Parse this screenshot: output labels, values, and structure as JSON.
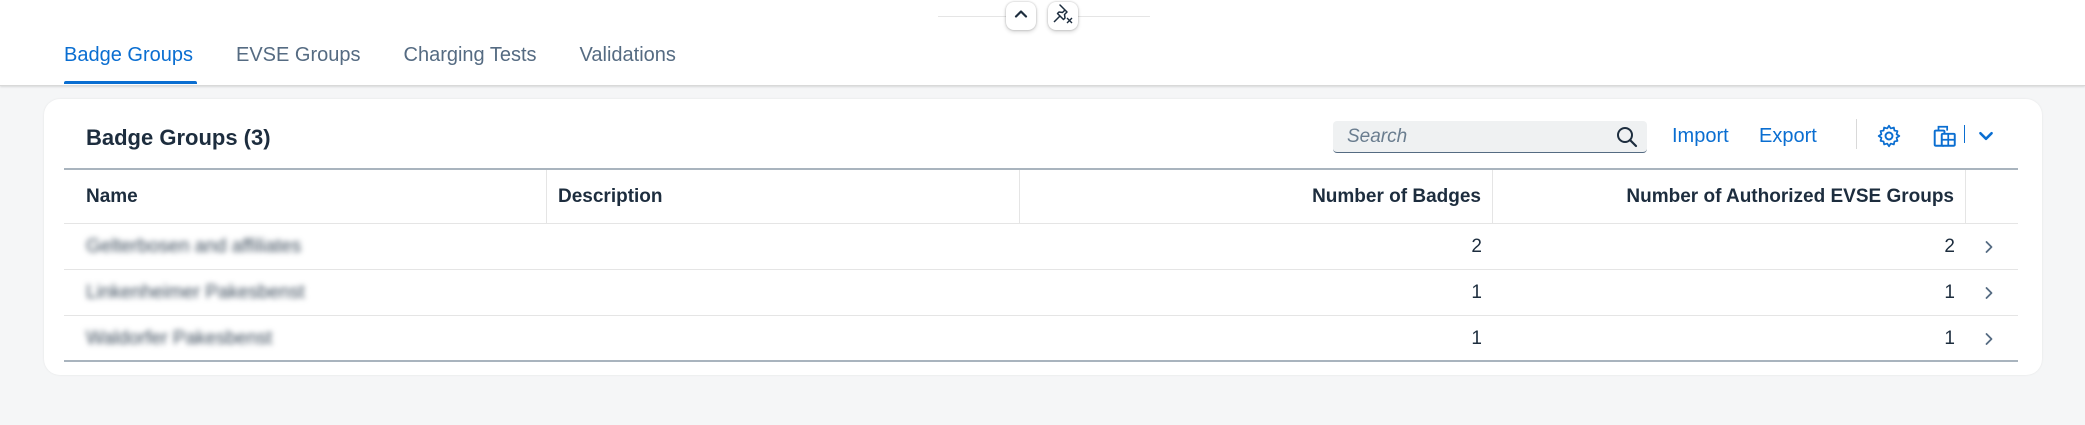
{
  "header": {
    "collapse_icon": "chevron-up-icon",
    "unpin_icon": "unpin-icon"
  },
  "tabs": [
    {
      "label": "Badge Groups",
      "active": true
    },
    {
      "label": "EVSE Groups",
      "active": false
    },
    {
      "label": "Charging Tests",
      "active": false
    },
    {
      "label": "Validations",
      "active": false
    }
  ],
  "card": {
    "title": "Badge Groups (3)",
    "search_placeholder": "Search",
    "import_label": "Import",
    "export_label": "Export",
    "settings_icon": "gear-icon",
    "export_table_icon": "export-spreadsheet-icon",
    "dropdown_icon": "chevron-down-icon"
  },
  "table": {
    "columns": [
      "Name",
      "Description",
      "Number of Badges",
      "Number of Authorized EVSE Groups"
    ],
    "rows": [
      {
        "name": "Gelterbosen and affiliates",
        "description": "",
        "badges": "2",
        "evse_groups": "2"
      },
      {
        "name": "Linkenheimer Pakesbenst",
        "description": "",
        "badges": "1",
        "evse_groups": "1"
      },
      {
        "name": "Waldorfer Pakesbenst",
        "description": "",
        "badges": "1",
        "evse_groups": "1"
      }
    ]
  },
  "colors": {
    "accent": "#0a6ed1",
    "text": "#1d2d3e",
    "muted": "#556b82",
    "background": "#f5f6f7"
  }
}
